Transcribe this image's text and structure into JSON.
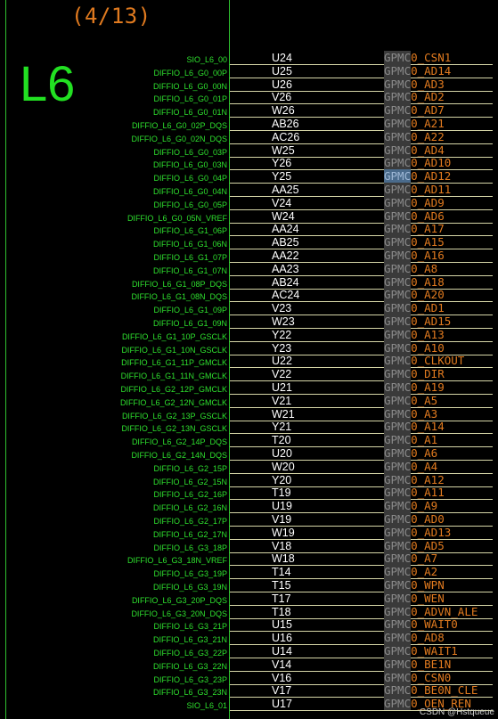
{
  "page_counter": "(4/13)",
  "bank_label": "L6",
  "watermark": "CSDN @Hstqueue",
  "rows": [
    {
      "signal": "SIO_L6_00",
      "pin": "U24",
      "pre": "GPMC",
      "fn": "0_CSN1"
    },
    {
      "signal": "DIFFIO_L6_G0_00P",
      "pin": "U25",
      "pre": "GPMC",
      "fn": "0_AD14"
    },
    {
      "signal": "DIFFIO_L6_G0_00N",
      "pin": "U26",
      "pre": "GPMC",
      "fn": "0_AD3"
    },
    {
      "signal": "DIFFIO_L6_G0_01P",
      "pin": "V26",
      "pre": "GPMC",
      "fn": "0_AD2"
    },
    {
      "signal": "DIFFIO_L6_G0_01N",
      "pin": "W26",
      "pre": "GPMC",
      "fn": "0_AD7"
    },
    {
      "signal": "DIFFIO_L6_G0_02P_DQS",
      "pin": "AB26",
      "pre": "GPMC",
      "fn": "0_A21"
    },
    {
      "signal": "DIFFIO_L6_G0_02N_DQS",
      "pin": "AC26",
      "pre": "GPMC",
      "fn": "0_A22"
    },
    {
      "signal": "DIFFIO_L6_G0_03P",
      "pin": "W25",
      "pre": "GPMC",
      "fn": "0_AD4"
    },
    {
      "signal": "DIFFIO_L6_G0_03N",
      "pin": "Y26",
      "pre": "GPMC",
      "fn": "0_AD10"
    },
    {
      "signal": "DIFFIO_L6_G0_04P",
      "pin": "Y25",
      "pre": "GPMC",
      "fn": "0_AD12",
      "sel": true
    },
    {
      "signal": "DIFFIO_L6_G0_04N",
      "pin": "AA25",
      "pre": "GPMC",
      "fn": "0_AD11"
    },
    {
      "signal": "DIFFIO_L6_G0_05P",
      "pin": "V24",
      "pre": "GPMC",
      "fn": "0_AD9"
    },
    {
      "signal": "DIFFIO_L6_G0_05N_VREF",
      "pin": "W24",
      "pre": "GPMC",
      "fn": "0_AD6"
    },
    {
      "signal": "DIFFIO_L6_G1_06P",
      "pin": "AA24",
      "pre": "GPMC",
      "fn": "0_A17"
    },
    {
      "signal": "DIFFIO_L6_G1_06N",
      "pin": "AB25",
      "pre": "GPMC",
      "fn": "0_A15"
    },
    {
      "signal": "DIFFIO_L6_G1_07P",
      "pin": "AA22",
      "pre": "GPMC",
      "fn": "0_A16"
    },
    {
      "signal": "DIFFIO_L6_G1_07N",
      "pin": "AA23",
      "pre": "GPMC",
      "fn": "0_A8"
    },
    {
      "signal": "DIFFIO_L6_G1_08P_DQS",
      "pin": "AB24",
      "pre": "GPMC",
      "fn": "0_A18"
    },
    {
      "signal": "DIFFIO_L6_G1_08N_DQS",
      "pin": "AC24",
      "pre": "GPMC",
      "fn": "0_A20"
    },
    {
      "signal": "DIFFIO_L6_G1_09P",
      "pin": "V23",
      "pre": "GPMC",
      "fn": "0_AD1"
    },
    {
      "signal": "DIFFIO_L6_G1_09N",
      "pin": "W23",
      "pre": "GPMC",
      "fn": "0_AD15"
    },
    {
      "signal": "DIFFIO_L6_G1_10P_GSCLK",
      "pin": "Y22",
      "pre": "GPMC",
      "fn": "0_A13"
    },
    {
      "signal": "DIFFIO_L6_G1_10N_GSCLK",
      "pin": "Y23",
      "pre": "GPMC",
      "fn": "0_A10"
    },
    {
      "signal": "DIFFIO_L6_G1_11P_GMCLK",
      "pin": "U22",
      "pre": "GPMC",
      "fn": "0_CLKOUT"
    },
    {
      "signal": "DIFFIO_L6_G1_11N_GMCLK",
      "pin": "V22",
      "pre": "GPMC",
      "fn": "0_DIR"
    },
    {
      "signal": "DIFFIO_L6_G2_12P_GMCLK",
      "pin": "U21",
      "pre": "GPMC",
      "fn": "0_A19"
    },
    {
      "signal": "DIFFIO_L6_G2_12N_GMCLK",
      "pin": "V21",
      "pre": "GPMC",
      "fn": "0_A5"
    },
    {
      "signal": "DIFFIO_L6_G2_13P_GSCLK",
      "pin": "W21",
      "pre": "GPMC",
      "fn": "0_A3"
    },
    {
      "signal": "DIFFIO_L6_G2_13N_GSCLK",
      "pin": "Y21",
      "pre": "GPMC",
      "fn": "0_A14"
    },
    {
      "signal": "DIFFIO_L6_G2_14P_DQS",
      "pin": "T20",
      "pre": "GPMC",
      "fn": "0_A1"
    },
    {
      "signal": "DIFFIO_L6_G2_14N_DQS",
      "pin": "U20",
      "pre": "GPMC",
      "fn": "0_A6"
    },
    {
      "signal": "DIFFIO_L6_G2_15P",
      "pin": "W20",
      "pre": "GPMC",
      "fn": "0_A4"
    },
    {
      "signal": "DIFFIO_L6_G2_15N",
      "pin": "Y20",
      "pre": "GPMC",
      "fn": "0_A12"
    },
    {
      "signal": "DIFFIO_L6_G2_16P",
      "pin": "T19",
      "pre": "GPMC",
      "fn": "0_A11"
    },
    {
      "signal": "DIFFIO_L6_G2_16N",
      "pin": "U19",
      "pre": "GPMC",
      "fn": "0_A9"
    },
    {
      "signal": "DIFFIO_L6_G2_17P",
      "pin": "V19",
      "pre": "GPMC",
      "fn": "0_AD0"
    },
    {
      "signal": "DIFFIO_L6_G2_17N",
      "pin": "W19",
      "pre": "GPMC",
      "fn": "0_AD13"
    },
    {
      "signal": "DIFFIO_L6_G3_18P",
      "pin": "V18",
      "pre": "GPMC",
      "fn": "0_AD5"
    },
    {
      "signal": "DIFFIO_L6_G3_18N_VREF",
      "pin": "W18",
      "pre": "GPMC",
      "fn": "0_A7"
    },
    {
      "signal": "DIFFIO_L6_G3_19P",
      "pin": "T14",
      "pre": "GPMC",
      "fn": "0_A2"
    },
    {
      "signal": "DIFFIO_L6_G3_19N",
      "pin": "T15",
      "pre": "GPMC",
      "fn": "0_WPN"
    },
    {
      "signal": "DIFFIO_L6_G3_20P_DQS",
      "pin": "T17",
      "pre": "GPMC",
      "fn": "0_WEN"
    },
    {
      "signal": "DIFFIO_L6_G3_20N_DQS",
      "pin": "T18",
      "pre": "GPMC",
      "fn": "0_ADVN_ALE"
    },
    {
      "signal": "DIFFIO_L6_G3_21P",
      "pin": "U15",
      "pre": "GPMC",
      "fn": "0_WAIT0"
    },
    {
      "signal": "DIFFIO_L6_G3_21N",
      "pin": "U16",
      "pre": "GPMC",
      "fn": "0_AD8"
    },
    {
      "signal": "DIFFIO_L6_G3_22P",
      "pin": "U14",
      "pre": "GPMC",
      "fn": "0_WAIT1"
    },
    {
      "signal": "DIFFIO_L6_G3_22N",
      "pin": "V14",
      "pre": "GPMC",
      "fn": "0_BE1N"
    },
    {
      "signal": "DIFFIO_L6_G3_23P",
      "pin": "V16",
      "pre": "GPMC",
      "fn": "0_CSN0"
    },
    {
      "signal": "DIFFIO_L6_G3_23N",
      "pin": "V17",
      "pre": "GPMC",
      "fn": "0_BE0N_CLE"
    },
    {
      "signal": "SIO_L6_01",
      "pin": "U17",
      "pre": "GPMC",
      "fn": "0_OEN_REN"
    }
  ]
}
